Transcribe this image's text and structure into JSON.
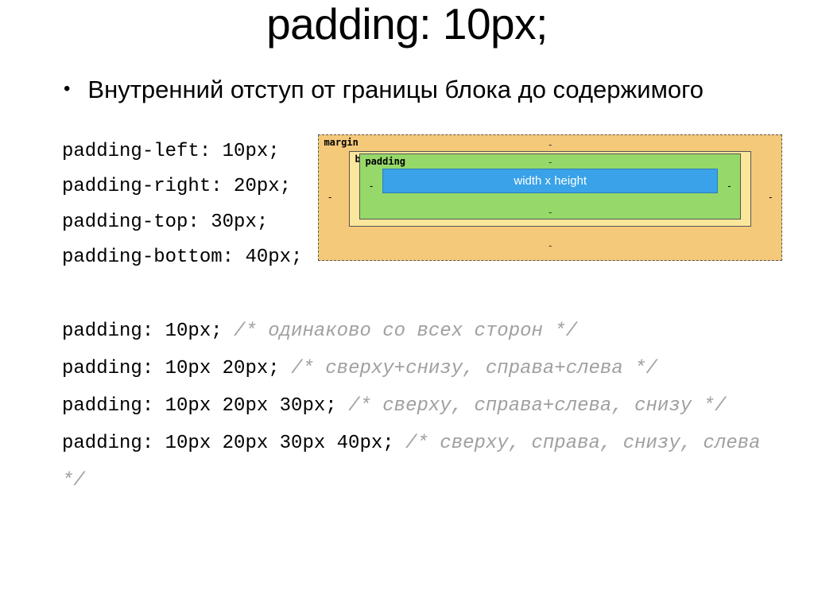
{
  "title": "padding: 10px;",
  "bullet": "Внутренний отступ от границы блока до содержимого",
  "code_lines": [
    "padding-left: 10px;",
    "padding-right: 20px;",
    "padding-top: 30px;",
    "padding-bottom: 40px;"
  ],
  "box_model": {
    "margin_label": "margin",
    "border_label": "border",
    "padding_label": "padding",
    "content_label": "width x height",
    "dash": "-"
  },
  "shorthand": [
    {
      "code": "padding: 10px;",
      "comment": "/* одинаково со всех сторон */"
    },
    {
      "code": "padding: 10px 20px;",
      "comment": "/* сверху+снизу, справа+слева */"
    },
    {
      "code": "padding: 10px 20px 30px;",
      "comment": "/* сверху, справа+слева, снизу */"
    },
    {
      "code": "padding: 10px 20px 30px 40px;",
      "comment": "/* сверху, справа, снизу, слева */"
    }
  ]
}
